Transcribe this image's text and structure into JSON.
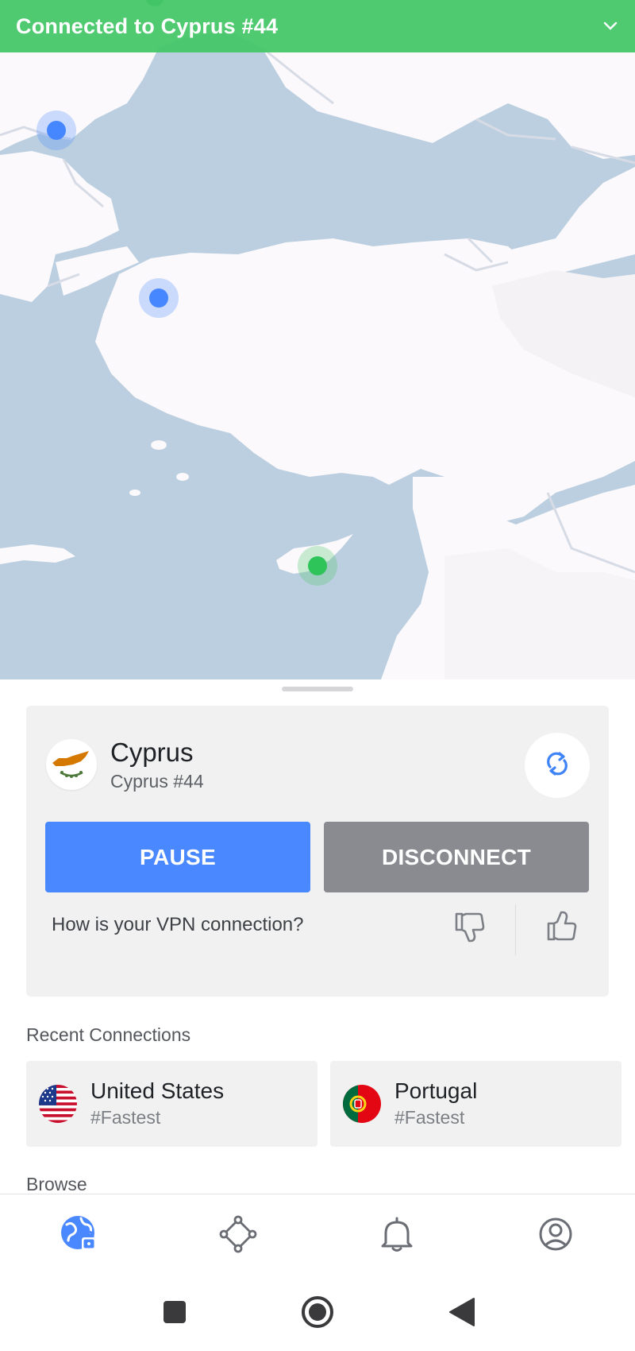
{
  "banner": {
    "title": "Connected to Cyprus #44",
    "chevron_icon": "chevron-down-icon"
  },
  "map": {
    "pins": [
      "server-pin",
      "server-pin",
      "connected-server-pin"
    ],
    "colors": {
      "water": "#bccfe0",
      "land": "#fbf9fb",
      "pin": "#4687ff",
      "connected_pin": "#2ec45a"
    }
  },
  "connection": {
    "country": "Cyprus",
    "server": "Cyprus #44",
    "refresh_icon": "refresh-icon",
    "pause_label": "PAUSE",
    "disconnect_label": "DISCONNECT",
    "feedback_question": "How is your VPN connection?",
    "thumbs_down_icon": "thumbs-down-icon",
    "thumbs_up_icon": "thumbs-up-icon"
  },
  "recent": {
    "title": "Recent Connections",
    "items": [
      {
        "name": "United States",
        "sub": "#Fastest",
        "flag": "us-flag-icon"
      },
      {
        "name": "Portugal",
        "sub": "#Fastest",
        "flag": "portugal-flag-icon"
      }
    ]
  },
  "browse": {
    "title": "Browse"
  },
  "bottom_nav": [
    "globe-lock-icon",
    "meshnet-icon",
    "bell-icon",
    "profile-icon"
  ],
  "system_nav": [
    "recents-icon",
    "home-icon",
    "back-icon"
  ],
  "colors": {
    "accent": "#4a88ff",
    "banner": "#43c666",
    "disconnect": "#8a8b90"
  }
}
